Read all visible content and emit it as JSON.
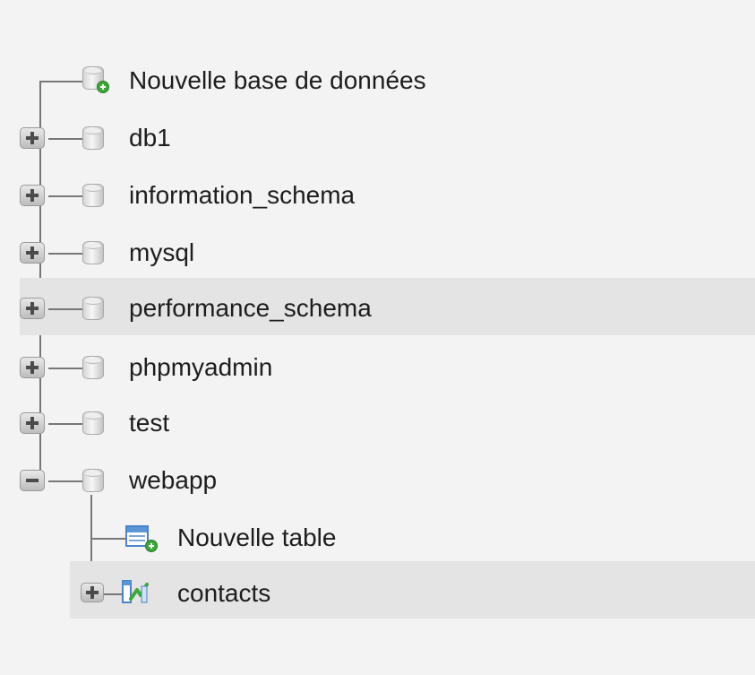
{
  "tree": {
    "new_database": "Nouvelle base de données",
    "databases": [
      "db1",
      "information_schema",
      "mysql",
      "performance_schema",
      "phpmyadmin",
      "test",
      "webapp"
    ],
    "highlighted_database": "performance_schema",
    "expanded_database": "webapp",
    "webapp_children": {
      "new_table": "Nouvelle table",
      "tables": [
        "contacts"
      ],
      "highlighted_table": "contacts"
    }
  },
  "icons": {
    "database": "database-icon",
    "new_database": "database-add-icon",
    "new_table": "table-add-icon",
    "table": "table-structure-icon",
    "expand": "plus-expand-icon",
    "collapse": "minus-collapse-icon"
  },
  "colors": {
    "highlight": "#e4e4e4",
    "background": "#f3f3f3",
    "tree_line": "#777777",
    "add_badge": "#3da83a",
    "table_blue": "#4b84c4"
  }
}
